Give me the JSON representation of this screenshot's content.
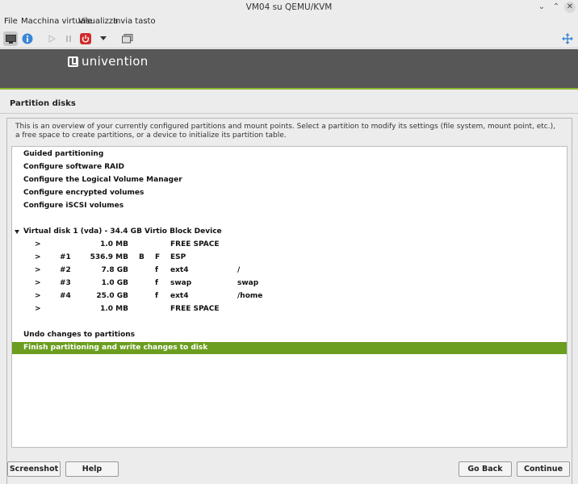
{
  "window": {
    "title": "VM04 su QEMU/KVM"
  },
  "menubar": {
    "items": [
      "File",
      "Macchina virtuale",
      "Visualizza",
      "Invia tasto"
    ]
  },
  "toolbar": {
    "icons": [
      "monitor-icon",
      "info-icon",
      "play-icon",
      "pause-icon",
      "power-icon",
      "dropdown-icon",
      "snapshot-icon",
      "fullscreen-icon"
    ]
  },
  "installer": {
    "brand": "univention",
    "section_title": "Partition disks",
    "description": "This is an overview of your currently configured partitions and mount points. Select a partition to modify its settings (file system, mount point, etc.), a free space to create partitions, or a device to initialize its partition table.",
    "menu": {
      "guided": "Guided partitioning",
      "raid": "Configure software RAID",
      "lvm": "Configure the Logical Volume Manager",
      "encrypted": "Configure encrypted volumes",
      "iscsi": "Configure iSCSI volumes"
    },
    "disk": "Virtual disk 1 (vda) - 34.4 GB Virtio Block Device",
    "partitions": [
      {
        "arrow": ">",
        "num": "",
        "size": "1.0 MB",
        "b": "",
        "f": "",
        "fs": "FREE SPACE",
        "mount": ""
      },
      {
        "arrow": ">",
        "num": "#1",
        "size": "536.9 MB",
        "b": "B",
        "f": "F",
        "fs": "ESP",
        "mount": ""
      },
      {
        "arrow": ">",
        "num": "#2",
        "size": "7.8 GB",
        "b": "",
        "f": "f",
        "fs": "ext4",
        "mount": "/"
      },
      {
        "arrow": ">",
        "num": "#3",
        "size": "1.0 GB",
        "b": "",
        "f": "f",
        "fs": "swap",
        "mount": "swap"
      },
      {
        "arrow": ">",
        "num": "#4",
        "size": "25.0 GB",
        "b": "",
        "f": "f",
        "fs": "ext4",
        "mount": "/home"
      },
      {
        "arrow": ">",
        "num": "",
        "size": "1.0 MB",
        "b": "",
        "f": "",
        "fs": "FREE SPACE",
        "mount": ""
      }
    ],
    "undo": "Undo changes to partitions",
    "finish": "Finish partitioning and write changes to disk",
    "buttons": {
      "screenshot": "Screenshot",
      "help": "Help",
      "goback": "Go Back",
      "continue": "Continue"
    },
    "colors": {
      "accent": "#6b9e1f",
      "banner": "#575757"
    }
  }
}
